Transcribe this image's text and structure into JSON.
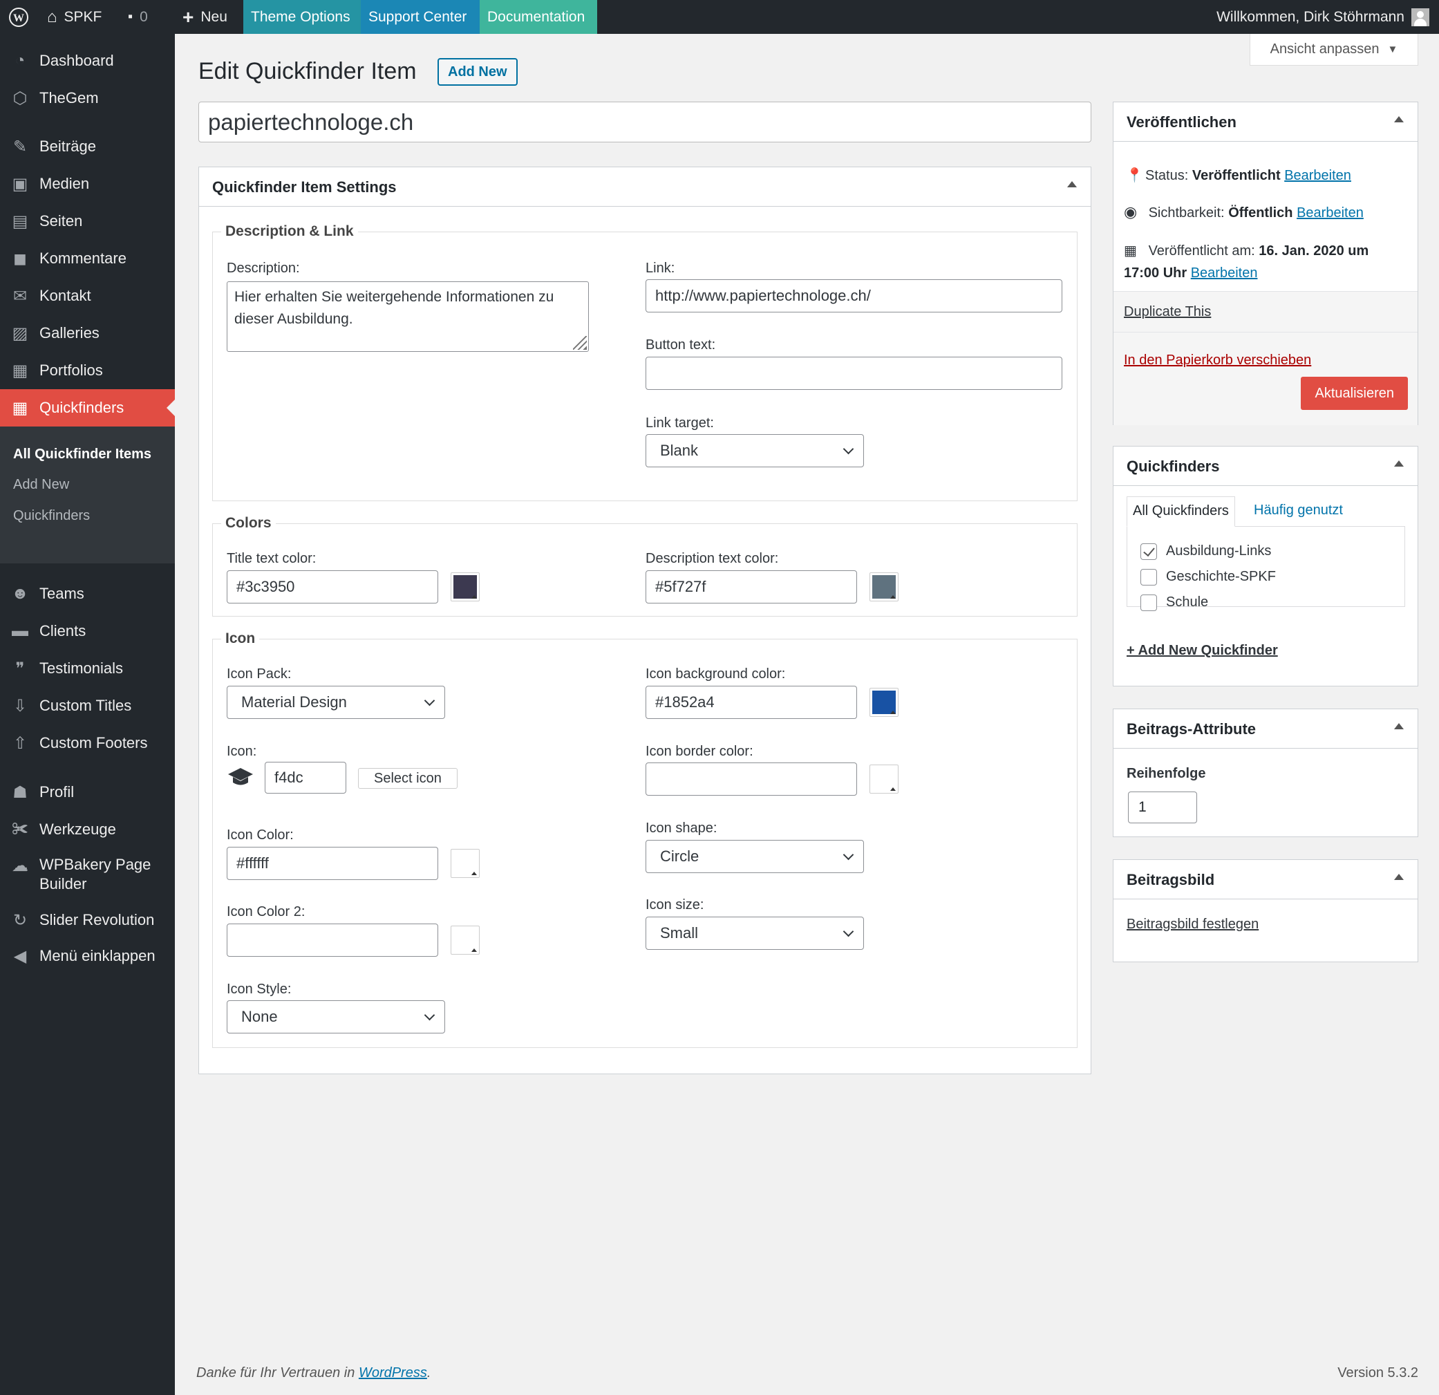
{
  "admin_bar": {
    "site_name": "SPKF",
    "comments_count": "0",
    "new_label": "Neu",
    "theme_options": "Theme Options",
    "support_center": "Support Center",
    "documentation": "Documentation",
    "welcome": "Willkommen, Dirk Stöhrmann"
  },
  "sidebar": {
    "items": [
      {
        "label": "Dashboard",
        "icon": "dashboard-icon"
      },
      {
        "label": "TheGem",
        "icon": "thegem-icon"
      },
      {
        "label": "Beiträge",
        "icon": "pin-icon"
      },
      {
        "label": "Medien",
        "icon": "media-icon"
      },
      {
        "label": "Seiten",
        "icon": "pages-icon"
      },
      {
        "label": "Kommentare",
        "icon": "comments-icon"
      },
      {
        "label": "Kontakt",
        "icon": "mail-icon"
      },
      {
        "label": "Galleries",
        "icon": "gallery-icon"
      },
      {
        "label": "Portfolios",
        "icon": "portfolio-icon"
      },
      {
        "label": "Quickfinders",
        "icon": "grid-icon"
      },
      {
        "label": "Teams",
        "icon": "teams-icon"
      },
      {
        "label": "Clients",
        "icon": "clients-icon"
      },
      {
        "label": "Testimonials",
        "icon": "quote-icon"
      },
      {
        "label": "Custom Titles",
        "icon": "download-icon"
      },
      {
        "label": "Custom Footers",
        "icon": "upload-icon"
      },
      {
        "label": "Profil",
        "icon": "user-icon"
      },
      {
        "label": "Werkzeuge",
        "icon": "wrench-icon"
      },
      {
        "label": "WPBakery Page",
        "label2": "Builder",
        "icon": "cloud-icon"
      },
      {
        "label": "Slider Revolution",
        "icon": "refresh-icon"
      },
      {
        "label": "Menü einklappen",
        "icon": "collapse-icon"
      }
    ],
    "submenu": [
      "All Quickfinder Items",
      "Add New",
      "Quickfinders"
    ]
  },
  "header": {
    "title": "Edit Quickfinder Item",
    "add_new": "Add New",
    "screen_options": "Ansicht anpassen"
  },
  "post_title": "papiertechnologe.ch",
  "settings": {
    "box_title": "Quickfinder Item Settings",
    "desc_link": {
      "legend": "Description & Link",
      "description_label": "Description:",
      "description_value": "Hier erhalten Sie weitergehende Informationen zu dieser Ausbildung.",
      "link_label": "Link:",
      "link_value": "http://www.papiertechnologe.ch/",
      "button_text_label": "Button text:",
      "button_text_value": "",
      "link_target_label": "Link target:",
      "link_target_value": "Blank"
    },
    "colors": {
      "legend": "Colors",
      "title_color_label": "Title text color:",
      "title_color_value": "#3c3950",
      "desc_color_label": "Description text color:",
      "desc_color_value": "#5f727f"
    },
    "icon": {
      "legend": "Icon",
      "pack_label": "Icon Pack:",
      "pack_value": "Material Design",
      "icon_label": "Icon:",
      "icon_value": "f4dc",
      "select_icon": "Select icon",
      "color_label": "Icon Color:",
      "color_value": "#ffffff",
      "color2_label": "Icon Color 2:",
      "color2_value": "",
      "style_label": "Icon Style:",
      "style_value": "None",
      "bg_color_label": "Icon background color:",
      "bg_color_value": "#1852a4",
      "border_color_label": "Icon border color:",
      "border_color_value": "",
      "shape_label": "Icon shape:",
      "shape_value": "Circle",
      "size_label": "Icon size:",
      "size_value": "Small"
    }
  },
  "publish": {
    "title": "Veröffentlichen",
    "status_label": "Status:",
    "status_value": "Veröffentlicht",
    "edit": "Bearbeiten",
    "visibility_label": "Sichtbarkeit:",
    "visibility_value": "Öffentlich",
    "published_label": "Veröffentlicht am:",
    "published_value": "16. Jan. 2020 um",
    "published_time": "17:00 Uhr",
    "duplicate": "Duplicate This",
    "trash": "In den Papierkorb verschieben",
    "update": "Aktualisieren"
  },
  "quickfinders_box": {
    "title": "Quickfinders",
    "tab_all": "All Quickfinders",
    "tab_popular": "Häufig genutzt",
    "items": [
      {
        "label": "Ausbildung-Links",
        "checked": true
      },
      {
        "label": "Geschichte-SPKF",
        "checked": false
      },
      {
        "label": "Schule",
        "checked": false
      }
    ],
    "add_new": "+ Add New Quickfinder"
  },
  "attributes_box": {
    "title": "Beitrags-Attribute",
    "order_label": "Reihenfolge",
    "order_value": "1"
  },
  "featured_box": {
    "title": "Beitragsbild",
    "set_link": "Beitragsbild festlegen"
  },
  "footer": {
    "thanks": "Danke für Ihr Vertrauen in",
    "wordpress": "WordPress",
    "version": "Version 5.3.2"
  },
  "colors": {
    "admin_bar": "#23282d",
    "active_menu": "#e14d43",
    "link": "#0073aa",
    "title_swatch": "#3c3950",
    "desc_swatch": "#5f727f",
    "bg_swatch": "#1852a4"
  }
}
